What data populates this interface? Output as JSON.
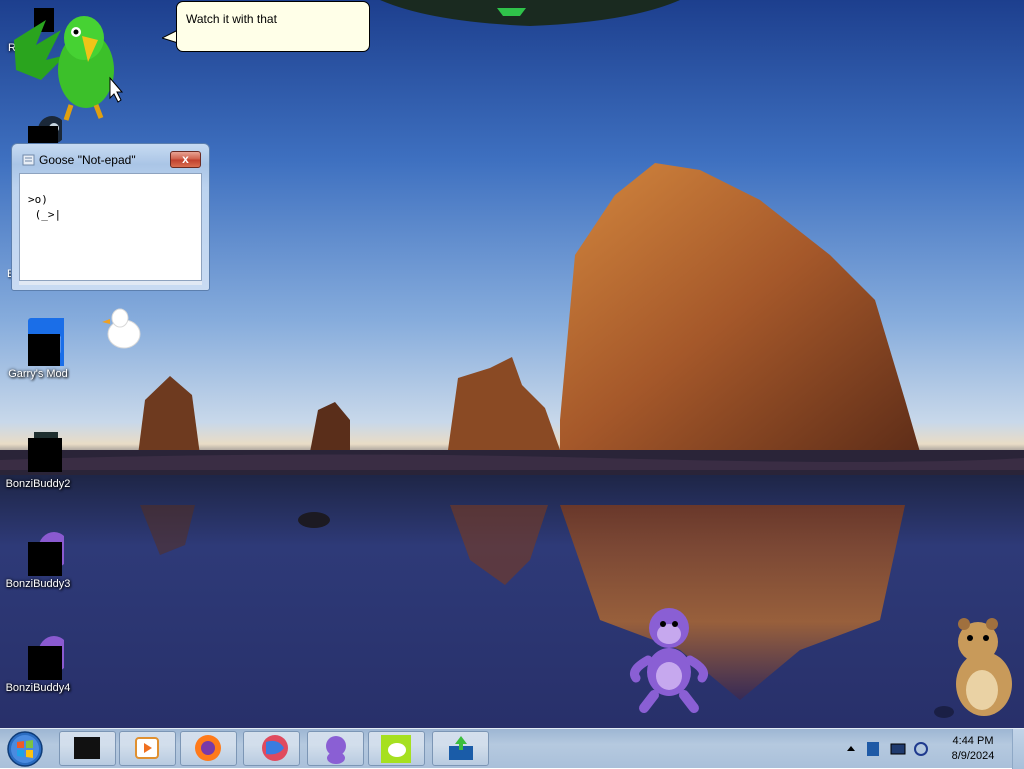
{
  "desktop": {
    "icons": [
      {
        "label": "R",
        "icon": "shortcut-icon"
      },
      {
        "label": "E",
        "icon": "steam-icon"
      },
      {
        "label": "Garry's Mod",
        "icon": "garrys-mod-icon"
      },
      {
        "label": "BonziBuddy2",
        "icon": "bonzibuddy-icon"
      },
      {
        "label": "BonziBuddy3",
        "icon": "bonzibuddy-icon"
      },
      {
        "label": "BonziBuddy4",
        "icon": "bonzibuddy-icon"
      }
    ]
  },
  "speech_bubble": {
    "text": "Watch it with that"
  },
  "goose_window": {
    "title": "Goose \"Not-epad\"",
    "close_label": "x",
    "text": ">o)\n (_>|"
  },
  "taskbar": {
    "pinned": [
      {
        "name": "terminal-icon"
      },
      {
        "name": "media-player-icon"
      },
      {
        "name": "firefox-icon"
      },
      {
        "name": "browser-icon"
      },
      {
        "name": "bonzibuddy-icon"
      },
      {
        "name": "goose-icon"
      },
      {
        "name": "upload-app-icon"
      }
    ],
    "clock": {
      "time": "4:44 PM",
      "date": "8/9/2024"
    }
  }
}
